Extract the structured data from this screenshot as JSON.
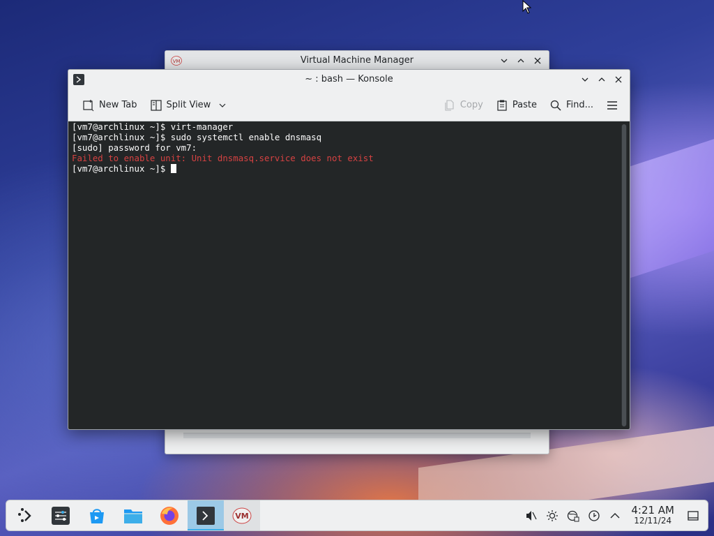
{
  "vmm_window": {
    "title": "Virtual Machine Manager"
  },
  "konsole": {
    "title": "~ : bash — Konsole",
    "toolbar": {
      "new_tab": "New Tab",
      "split_view": "Split View",
      "copy": "Copy",
      "paste": "Paste",
      "find": "Find..."
    },
    "terminal_lines": [
      {
        "text": "[vm7@archlinux ~]$ virt-manager",
        "type": "normal"
      },
      {
        "text": "[vm7@archlinux ~]$ sudo systemctl enable dnsmasq",
        "type": "normal"
      },
      {
        "text": "[sudo] password for vm7:",
        "type": "normal"
      },
      {
        "text": "Failed to enable unit: Unit dnsmasq.service does not exist",
        "type": "error"
      },
      {
        "text": "[vm7@archlinux ~]$ ",
        "type": "prompt"
      }
    ]
  },
  "taskbar": {
    "items": [
      {
        "name": "application-launcher",
        "icon": "kde-launcher-icon"
      },
      {
        "name": "system-settings",
        "icon": "settings-sliders-icon"
      },
      {
        "name": "discover",
        "icon": "discover-store-icon"
      },
      {
        "name": "dolphin",
        "icon": "folder-icon"
      },
      {
        "name": "firefox",
        "icon": "firefox-icon"
      },
      {
        "name": "konsole",
        "icon": "terminal-icon"
      },
      {
        "name": "virt-manager",
        "icon": "vmm-icon"
      }
    ],
    "tray": {
      "icons": [
        "speaker-muted-icon",
        "brightness-icon",
        "network-icon",
        "updates-icon",
        "chevron-up-icon"
      ],
      "time": "4:21 AM",
      "date": "12/11/24"
    }
  },
  "colors": {
    "terminal_bg": "#232627",
    "terminal_fg": "#fcfcfc",
    "error_fg": "#d64242",
    "accent": "#3daee9"
  }
}
